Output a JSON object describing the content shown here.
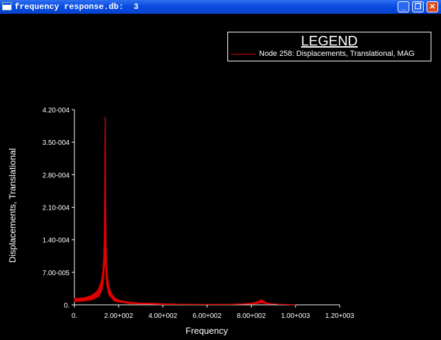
{
  "window": {
    "title": "frequency response.db:  3",
    "controls": {
      "minimize": "_",
      "maximize": "❐",
      "close": "✕"
    }
  },
  "legend": {
    "title": "LEGEND",
    "entry": "Node 258: Displacements, Translational, MAG",
    "entry_color": "#e00000"
  },
  "chart_data": {
    "type": "line",
    "xlabel": "Frequency",
    "ylabel": "Displacements, Translational",
    "xlim": [
      0,
      1200
    ],
    "ylim": [
      0,
      0.00042
    ],
    "x_tick_values": [
      0,
      200,
      400,
      600,
      800,
      1000,
      1200
    ],
    "x_tick_labels": [
      "0.",
      "2.00+002",
      "4.00+002",
      "6.00+002",
      "8.00+002",
      "1.00+003",
      "1.20+003"
    ],
    "y_tick_values": [
      0,
      7e-05,
      0.00014,
      0.00021,
      0.00028,
      0.00035,
      0.00042
    ],
    "y_tick_labels": [
      "0.",
      "7.00-005",
      "1.40-004",
      "2.10-004",
      "2.80-004",
      "3.50-004",
      "4.20-004"
    ],
    "grid": false,
    "legend_position": "top-right",
    "series": [
      {
        "name": "Node 258: Displacements, Translational, MAG",
        "color": "#e00000",
        "upper": [
          [
            0,
            1.4e-05
          ],
          [
            20,
            1.4e-05
          ],
          [
            40,
            1.5e-05
          ],
          [
            60,
            1.7e-05
          ],
          [
            80,
            2.1e-05
          ],
          [
            100,
            2.8e-05
          ],
          [
            110,
            3.5e-05
          ],
          [
            120,
            4.8e-05
          ],
          [
            125,
            6e-05
          ],
          [
            130,
            8e-05
          ],
          [
            133,
            0.00011
          ],
          [
            135,
            0.00015
          ],
          [
            137,
            0.00023
          ],
          [
            138,
            0.00033
          ],
          [
            139,
            0.000405
          ],
          [
            140,
            0.00037
          ],
          [
            141,
            0.00024
          ],
          [
            143,
            0.00014
          ],
          [
            145,
            9e-05
          ],
          [
            150,
            6e-05
          ],
          [
            155,
            4.2e-05
          ],
          [
            165,
            2.6e-05
          ],
          [
            180,
            1.6e-05
          ],
          [
            200,
            1e-05
          ],
          [
            250,
            5.5e-06
          ],
          [
            300,
            3.7e-06
          ],
          [
            350,
            3.5e-06
          ],
          [
            400,
            2.2e-06
          ],
          [
            500,
            1.2e-06
          ],
          [
            600,
            9e-07
          ],
          [
            700,
            1.2e-06
          ],
          [
            760,
            2e-06
          ],
          [
            800,
            3.5e-06
          ],
          [
            820,
            5.5e-06
          ],
          [
            835,
            8.5e-06
          ],
          [
            845,
            1.1e-05
          ],
          [
            850,
            9.5e-06
          ],
          [
            860,
            6.5e-06
          ],
          [
            880,
            3e-06
          ],
          [
            920,
            1.2e-06
          ],
          [
            1000,
            4e-07
          ]
        ],
        "lower": [
          [
            0,
            7e-06
          ],
          [
            40,
            8e-06
          ],
          [
            80,
            1.1e-05
          ],
          [
            110,
            1.8e-05
          ],
          [
            125,
            3.2e-05
          ],
          [
            133,
            6e-05
          ],
          [
            137,
            9e-05
          ],
          [
            139,
            9.5e-05
          ],
          [
            141,
            8e-05
          ],
          [
            145,
            4.5e-05
          ],
          [
            155,
            2.2e-05
          ],
          [
            180,
            8e-06
          ],
          [
            250,
            2.5e-06
          ],
          [
            400,
            8e-07
          ],
          [
            700,
            5e-07
          ],
          [
            820,
            2e-06
          ],
          [
            845,
            4.5e-06
          ],
          [
            870,
            2e-06
          ],
          [
            1000,
            2e-07
          ]
        ]
      }
    ]
  }
}
